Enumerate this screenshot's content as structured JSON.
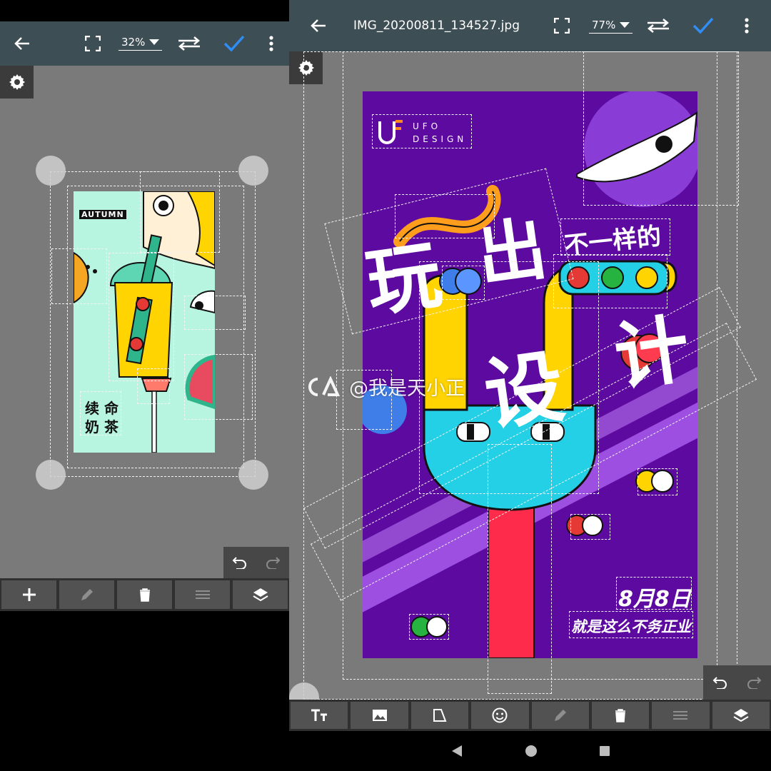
{
  "left_panel": {
    "zoom": "32%",
    "poster": {
      "autumn_badge": "AUTUMN",
      "text_line1": "续 命",
      "text_line2": "奶 茶"
    },
    "bottom_toolbar": [
      "add-icon",
      "pencil-icon",
      "trash-icon",
      "menu-lines-icon",
      "layers-icon"
    ]
  },
  "right_panel": {
    "file_name": "IMG_20200811_134527.jpg",
    "zoom": "77%",
    "poster": {
      "logo_text_top": "UFO",
      "logo_text_bottom": "DESIGN",
      "headline_play": "玩",
      "headline_out": "出",
      "headline_small": "不一样的",
      "headline_design": "设",
      "headline_meter": "计",
      "date_text": "8月8日",
      "slogan": "就是这么不务正业"
    },
    "bottom_toolbar": [
      "text-size-icon",
      "image-icon",
      "shape-icon",
      "emoji-icon",
      "pencil-icon",
      "trash-icon",
      "menu-lines-icon",
      "layers-icon"
    ]
  },
  "watermark": "@我是天小正",
  "colors": {
    "toolbar": "#3d4e55",
    "accent_check": "#2f8df5",
    "canvas": "#7a7a7a",
    "purple_bg": "#5d0aa0",
    "mint_bg": "#b7f5e1"
  }
}
